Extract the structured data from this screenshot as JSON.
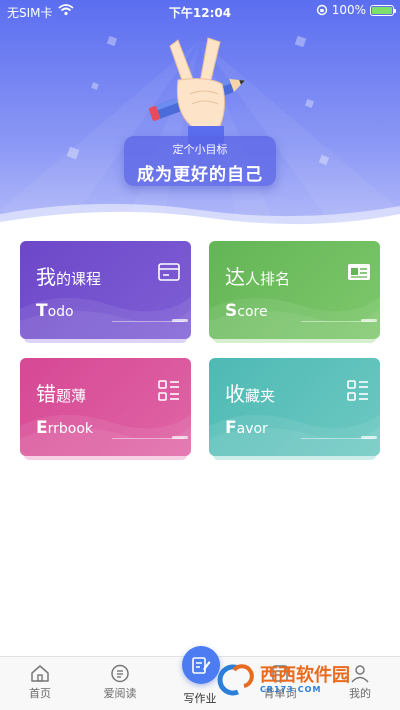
{
  "status_bar": {
    "carrier": "无SIM卡",
    "time": "下午12:04",
    "battery_label": "100%"
  },
  "hero": {
    "subtitle": "定个小目标",
    "title": "成为更好的自己"
  },
  "cards": [
    {
      "title_first": "我",
      "title_rest": "的课程",
      "sub_first": "T",
      "sub_rest": "odo",
      "icon": "card-icon",
      "color": "#6d47c8"
    },
    {
      "title_first": "达",
      "title_rest": "人排名",
      "sub_first": "S",
      "sub_rest": "core",
      "icon": "id-card-icon",
      "color": "#63b556"
    },
    {
      "title_first": "错",
      "title_rest": "题薄",
      "sub_first": "E",
      "sub_rest": "rrbook",
      "icon": "list-icon",
      "color": "#d64894"
    },
    {
      "title_first": "收",
      "title_rest": "藏夹",
      "sub_first": "F",
      "sub_rest": "avor",
      "icon": "list-icon",
      "color": "#4fb9b4"
    }
  ],
  "tabbar": {
    "items": [
      {
        "label": "首页",
        "icon": "home-icon"
      },
      {
        "label": "爱阅读",
        "icon": "read-icon"
      },
      {
        "label": "写作业",
        "icon": "edit-icon"
      },
      {
        "label": "背单词",
        "icon": "words-icon"
      },
      {
        "label": "我的",
        "icon": "profile-icon"
      }
    ]
  },
  "watermark": {
    "text": "西西软件园",
    "sub": "CR173.COM"
  },
  "colors": {
    "primary": "#5b6ef0",
    "tab_active": "#4d7cf2"
  }
}
